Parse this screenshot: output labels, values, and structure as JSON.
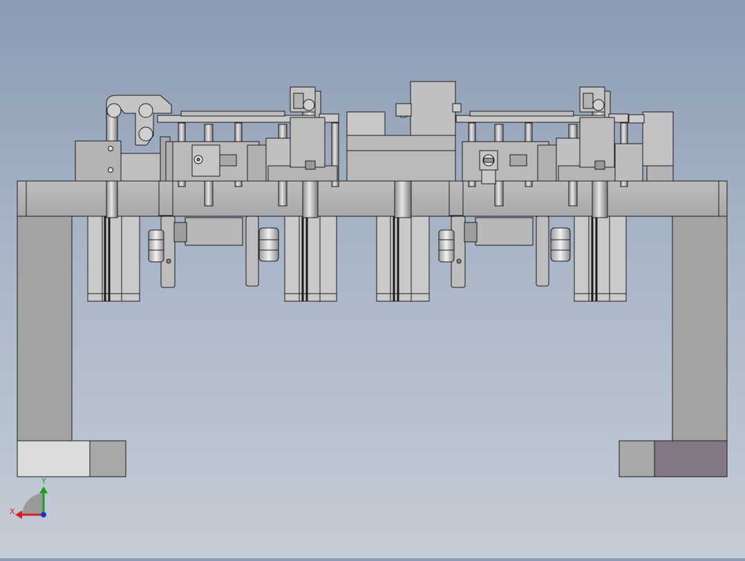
{
  "viewport": {
    "background_top": "#8a9bb3",
    "background_bottom": "#c4ccd6",
    "part_color": "#b5b5b5",
    "part_color_light": "#d4d4d4",
    "edge_color": "#1a1a1a",
    "highlight_color": "#847887"
  },
  "triad": {
    "x_label": "X",
    "y_label": "Y",
    "x_color": "#d42020",
    "y_color": "#1aa01a",
    "z_color": "#2030d0"
  }
}
